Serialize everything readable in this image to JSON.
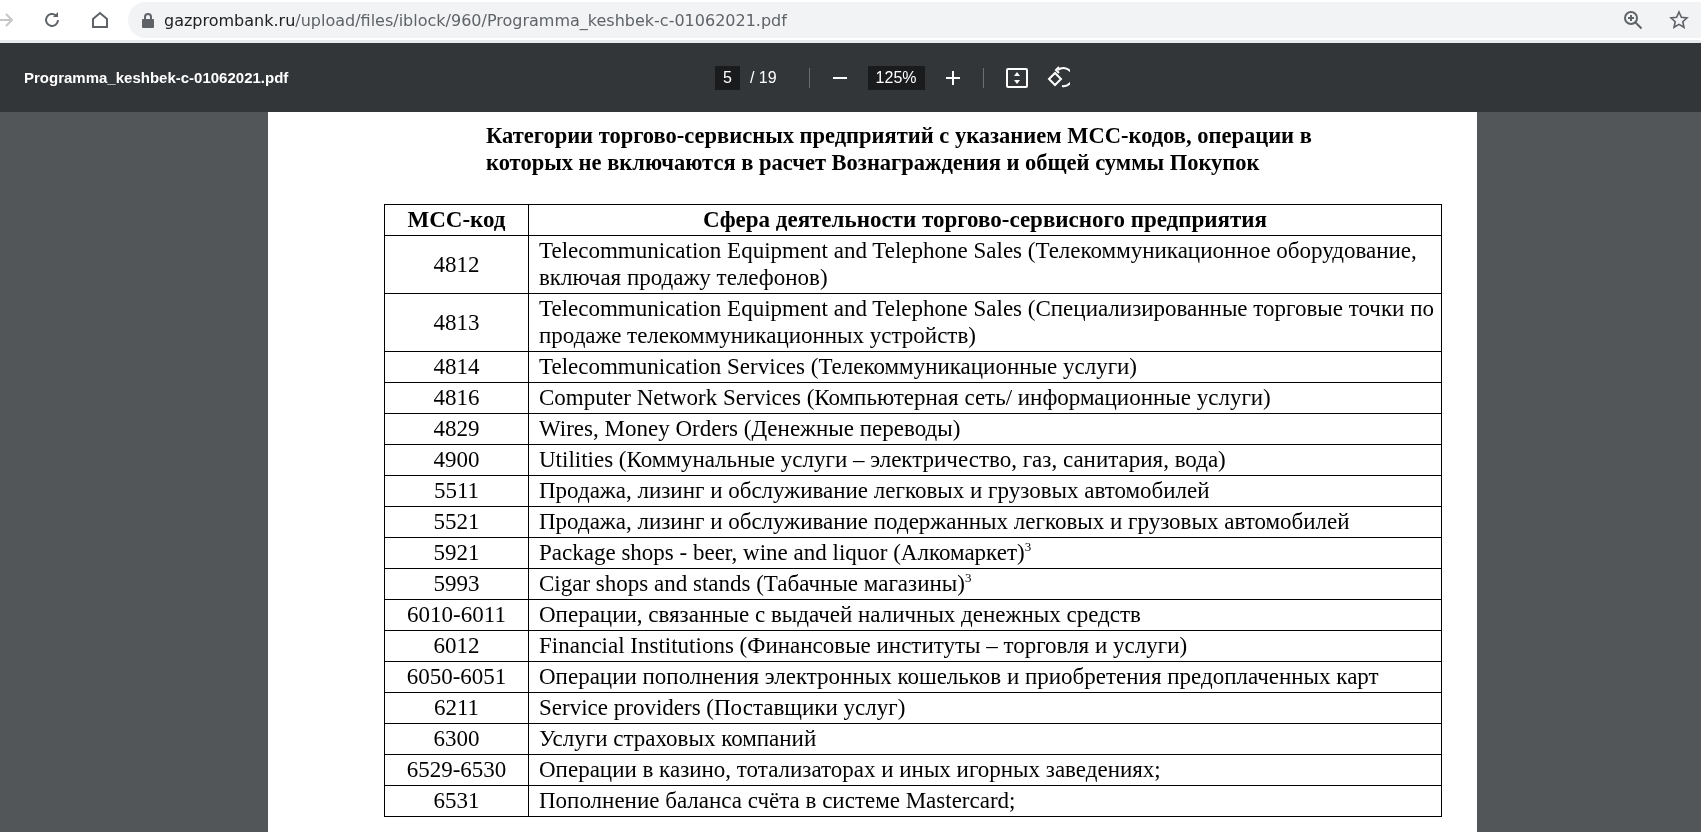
{
  "browser": {
    "url_host": "gazprombank.ru",
    "url_path": "/upload/files/iblock/960/Programma_keshbek-c-01062021.pdf"
  },
  "pdf_toolbar": {
    "title": "Programma_keshbek-c-01062021.pdf",
    "page": "5",
    "page_total": "/ 19",
    "zoom": "125%"
  },
  "document": {
    "heading": "Категории торгово-сервисных предприятий с указанием МСС-кодов, операции в которых не включаются в расчет Вознаграждения и общей суммы Покупок",
    "table": {
      "columns": [
        "МСС-код",
        "Сфера деятельности торгово-сервисного предприятия"
      ],
      "rows": [
        {
          "code": "4812",
          "description": "Telecommunication Equipment and Telephone Sales (Телекоммуникационное оборудование, включая продажу телефонов)"
        },
        {
          "code": "4813",
          "description": "Telecommunication Equipment and Telephone Sales (Специализированные торговые точки по продаже телекоммуникационных устройств)"
        },
        {
          "code": "4814",
          "description": "Telecommunication Services (Телекоммуникационные услуги)"
        },
        {
          "code": "4816",
          "description": "Computer Network Services (Компьютерная сеть/ информационные услуги)"
        },
        {
          "code": "4829",
          "description": "Wires, Money Orders (Денежные переводы)"
        },
        {
          "code": "4900",
          "description": "Utilities  (Коммунальные услуги – электричество, газ, санитария, вода)"
        },
        {
          "code": "5511",
          "description": "Продажа, лизинг и обслуживание легковых и грузовых автомобилей"
        },
        {
          "code": "5521",
          "description": "Продажа, лизинг и обслуживание подержанных легковых и грузовых автомобилей"
        },
        {
          "code": "5921",
          "description": "Package shops - beer, wine and liquor (Алкомаркет)$^{3}$"
        },
        {
          "code": "5993",
          "description": "Cigar shops and stands (Табачные магазины)$^{3}$"
        },
        {
          "code": "6010-6011",
          "description": "Операции, связанные с выдачей наличных денежных средств"
        },
        {
          "code": "6012",
          "description": "Financial Institutions (Финансовые институты – торговля и услуги)"
        },
        {
          "code": "6050-6051",
          "description": "Операции пополнения электронных кошельков и приобретения предоплаченных карт"
        },
        {
          "code": "6211",
          "description": "Service providers (Поставщики услуг)"
        },
        {
          "code": "6300",
          "description": "Услуги страховых компаний"
        },
        {
          "code": "6529-6530",
          "description": "Операции в казино, тотализаторах и иных игорных заведениях;"
        },
        {
          "code": "6531",
          "description": "Пополнение баланса счёта в системе Mastercard;"
        }
      ]
    }
  }
}
